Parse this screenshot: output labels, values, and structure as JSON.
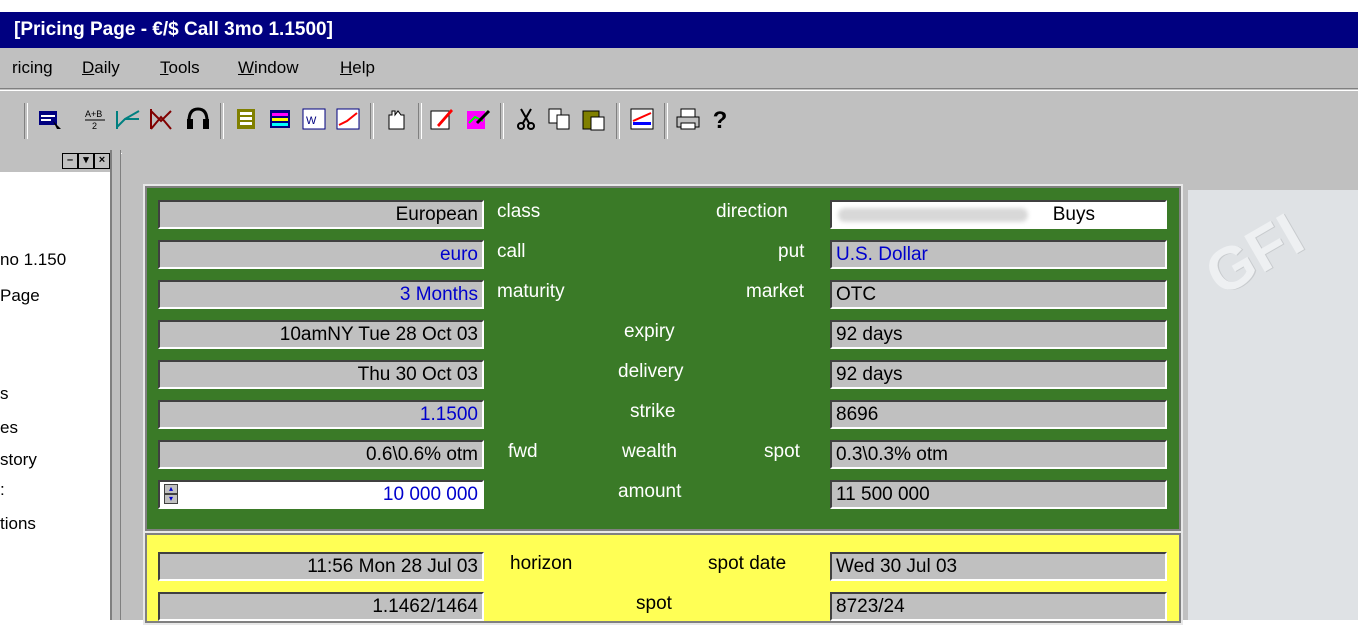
{
  "window": {
    "title": "[Pricing Page - €/$ Call 3mo 1.1500]"
  },
  "menu": [
    {
      "pre": "ricing",
      "ul": "",
      "post": ""
    },
    {
      "pre": "",
      "ul": "D",
      "post": "aily"
    },
    {
      "pre": "",
      "ul": "T",
      "post": "ools"
    },
    {
      "pre": "",
      "ul": "W",
      "post": "indow"
    },
    {
      "pre": "",
      "ul": "H",
      "post": "elp"
    }
  ],
  "toolbar": {
    "icons": [
      "report-icon",
      "average-icon",
      "call-spread-icon",
      "butterfly-icon",
      "headset-icon",
      "ticket-icon",
      "calculator-icon",
      "weekly-chart-icon",
      "line-chart-icon",
      "hand-icon",
      "edit-icon",
      "chart-edit-icon",
      "cut-icon",
      "copy-icon",
      "paste-icon",
      "graph-icon",
      "print-icon",
      "help-icon"
    ]
  },
  "left_panel": {
    "items": [
      "no 1.150",
      "Page",
      "s",
      "es",
      "story",
      ":",
      "tions"
    ]
  },
  "watermark": "GFI",
  "pricing": {
    "rows": [
      {
        "left": "European",
        "mid_left": "class",
        "mid_center": "",
        "mid_right": "direction",
        "right": "Buys"
      },
      {
        "left": "euro",
        "mid_left": "call",
        "mid_center": "",
        "mid_right": "put",
        "right": "U.S. Dollar"
      },
      {
        "left": "3 Months",
        "mid_left": "maturity",
        "mid_center": "",
        "mid_right": "market",
        "right": "OTC"
      },
      {
        "left": "10amNY Tue 28 Oct 03",
        "mid_left": "",
        "mid_center": "expiry",
        "mid_right": "",
        "right": "92 days"
      },
      {
        "left": "Thu 30 Oct 03",
        "mid_left": "",
        "mid_center": "delivery",
        "mid_right": "",
        "right": "92 days"
      },
      {
        "left": "1.1500",
        "mid_left": "",
        "mid_center": "strike",
        "mid_right": "",
        "right": "8696"
      },
      {
        "left": "0.6\\0.6% otm",
        "mid_left": "fwd",
        "mid_center": "wealth",
        "mid_right": "spot",
        "right": "0.3\\0.3% otm"
      },
      {
        "left": "10 000 000",
        "mid_left": "",
        "mid_center": "amount",
        "mid_right": "",
        "right": "11 500 000"
      }
    ]
  },
  "market": {
    "rows": [
      {
        "left": "11:56 Mon 28 Jul 03",
        "mid_left": "horizon",
        "mid_center": "",
        "mid_right": "spot date",
        "right": "Wed 30 Jul 03"
      },
      {
        "left": "1.1462/1464",
        "mid_left": "",
        "mid_center": "spot",
        "mid_right": "",
        "right": "8723/24"
      }
    ]
  },
  "colors": {
    "title_bar": "#000080",
    "pricing_panel": "#3a7a27",
    "market_panel": "#ffff55",
    "link_text": "#0000cc"
  }
}
